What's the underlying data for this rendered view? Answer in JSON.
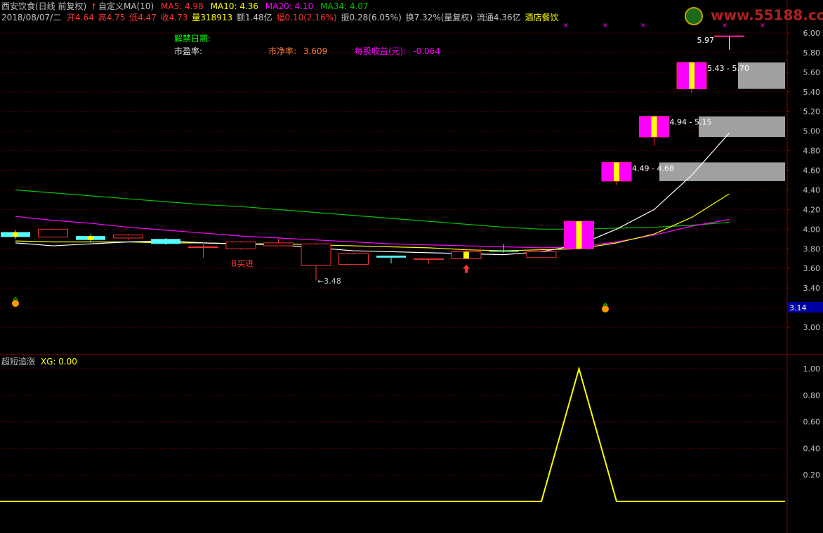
{
  "header": {
    "title": "西安饮食(日线 前复权)",
    "indicator_name": "自定义MA(10)",
    "ma5_label": "MA5: 4.98",
    "ma10_label": "MA10: 4.36",
    "ma20_label": "MA20: 4.10",
    "ma34_label": "MA34: 4.07",
    "date": "2018/08/07/二",
    "open_label": "开4.64",
    "high_label": "高4.75",
    "low_label": "低4.47",
    "close_label": "收4.73",
    "volume_label": "量318913",
    "amount_label": "额1.48亿",
    "change_label": "幅0.10(2.16%)",
    "amplitude_label": "振0.28(6.05%)",
    "turnover_label": "换7.32%(量复权)",
    "float_label": "流通4.36亿",
    "industry": "酒店餐饮",
    "watermark": "www.55188.com"
  },
  "info": {
    "lift_ban_date": "解禁日期:",
    "pe_ratio": "市盈率:",
    "pb_label": "市净率:",
    "pb_value": "3.609",
    "eps_label": "每股收益(元):",
    "eps_value": "-0.064"
  },
  "annotations": {
    "buy_signal": "B买进",
    "low_mark": "3.48",
    "high_mark": "5.97",
    "range1": "4.49 - 4.68",
    "range2": "4.94 - 5.15",
    "range3": "5.43 - 5.70",
    "current_price": "3.14"
  },
  "colors": {
    "up": "#ff3232",
    "down": "#54ffff",
    "ma5": "#ffffff",
    "ma10": "#ffff00",
    "ma20": "#ff00ff",
    "ma34": "#00c000",
    "grid": "#8b0000",
    "yellow_line": "#ffff00",
    "magenta_box": "#ff00ff",
    "gray_box": "#a0a0a0"
  },
  "price_axis": {
    "ticks": [
      "6.00",
      "5.80",
      "5.60",
      "5.40",
      "5.20",
      "5.00",
      "4.80",
      "4.60",
      "4.40",
      "4.20",
      "4.00",
      "3.80",
      "3.60",
      "3.40",
      "3.20",
      "3.00"
    ],
    "range": [
      3.0,
      6.0
    ]
  },
  "indicator": {
    "label": "超短追涨",
    "value_label": "XG: 0.00",
    "ticks": [
      "1.00",
      "0.80",
      "0.60",
      "0.40",
      "0.20"
    ],
    "range": [
      0,
      1
    ]
  },
  "chart_data": {
    "type": "candlestick",
    "candles": [
      {
        "o": 3.97,
        "c": 3.92,
        "h": 3.99,
        "l": 3.9
      },
      {
        "o": 3.92,
        "c": 4.0,
        "h": 4.01,
        "l": 3.91
      },
      {
        "o": 3.93,
        "c": 3.89,
        "h": 3.95,
        "l": 3.87
      },
      {
        "o": 3.91,
        "c": 3.94,
        "h": 3.95,
        "l": 3.89
      },
      {
        "o": 3.9,
        "c": 3.85,
        "h": 3.91,
        "l": 3.84
      },
      {
        "o": 3.82,
        "c": 3.82,
        "h": 3.87,
        "l": 3.71
      },
      {
        "o": 3.8,
        "c": 3.87,
        "h": 3.88,
        "l": 3.79
      },
      {
        "o": 3.83,
        "c": 3.86,
        "h": 3.9,
        "l": 3.83
      },
      {
        "o": 3.63,
        "c": 3.85,
        "h": 3.86,
        "l": 3.48
      },
      {
        "o": 3.64,
        "c": 3.75,
        "h": 3.76,
        "l": 3.64
      },
      {
        "o": 3.73,
        "c": 3.71,
        "h": 3.73,
        "l": 3.65
      },
      {
        "o": 3.69,
        "c": 3.7,
        "h": 3.7,
        "l": 3.65
      },
      {
        "o": 3.7,
        "c": 3.77,
        "h": 3.79,
        "l": 3.69
      },
      {
        "o": 3.78,
        "c": 3.77,
        "h": 3.85,
        "l": 3.76
      },
      {
        "o": 3.71,
        "c": 3.77,
        "h": 3.78,
        "l": 3.7
      },
      {
        "o": 3.8,
        "c": 4.08,
        "h": 4.09,
        "l": 3.79
      },
      {
        "o": 4.49,
        "c": 4.68,
        "h": 4.69,
        "l": 4.45
      },
      {
        "o": 4.94,
        "c": 5.15,
        "h": 5.16,
        "l": 4.85
      },
      {
        "o": 5.43,
        "c": 5.7,
        "h": 5.71,
        "l": 5.39
      },
      {
        "o": 5.97,
        "c": 5.97,
        "h": 5.97,
        "l": 5.83
      }
    ],
    "ma5": [
      3.86,
      3.83,
      3.85,
      3.87,
      3.88,
      3.86,
      3.85,
      3.84,
      3.81,
      3.78,
      3.77,
      3.76,
      3.75,
      3.74,
      3.77,
      3.84,
      4.0,
      4.2,
      4.55,
      4.98
    ],
    "ma10": [
      3.88,
      3.87,
      3.87,
      3.87,
      3.86,
      3.86,
      3.85,
      3.85,
      3.84,
      3.83,
      3.82,
      3.81,
      3.79,
      3.78,
      3.79,
      3.8,
      3.86,
      3.95,
      4.12,
      4.36
    ],
    "ma20": [
      4.13,
      4.09,
      4.06,
      4.02,
      3.99,
      3.96,
      3.93,
      3.91,
      3.89,
      3.87,
      3.85,
      3.84,
      3.83,
      3.82,
      3.81,
      3.82,
      3.87,
      3.94,
      4.03,
      4.1
    ],
    "ma34": [
      4.4,
      4.37,
      4.34,
      4.31,
      4.28,
      4.25,
      4.23,
      4.2,
      4.17,
      4.14,
      4.11,
      4.08,
      4.05,
      4.02,
      4.0,
      4.0,
      4.01,
      4.02,
      4.04,
      4.07
    ],
    "red_boxes": [
      [
        4.49,
        4.68
      ],
      [
        4.94,
        5.15
      ],
      [
        5.43,
        5.7
      ]
    ],
    "gray_boxes": [
      [
        4.49,
        4.68
      ],
      [
        4.94,
        5.15
      ],
      [
        5.43,
        5.7
      ]
    ],
    "xg": [
      0,
      0,
      0,
      0,
      0,
      0,
      0,
      0,
      0,
      0,
      0,
      0,
      0,
      0,
      0,
      1,
      0,
      0,
      0,
      0
    ]
  }
}
